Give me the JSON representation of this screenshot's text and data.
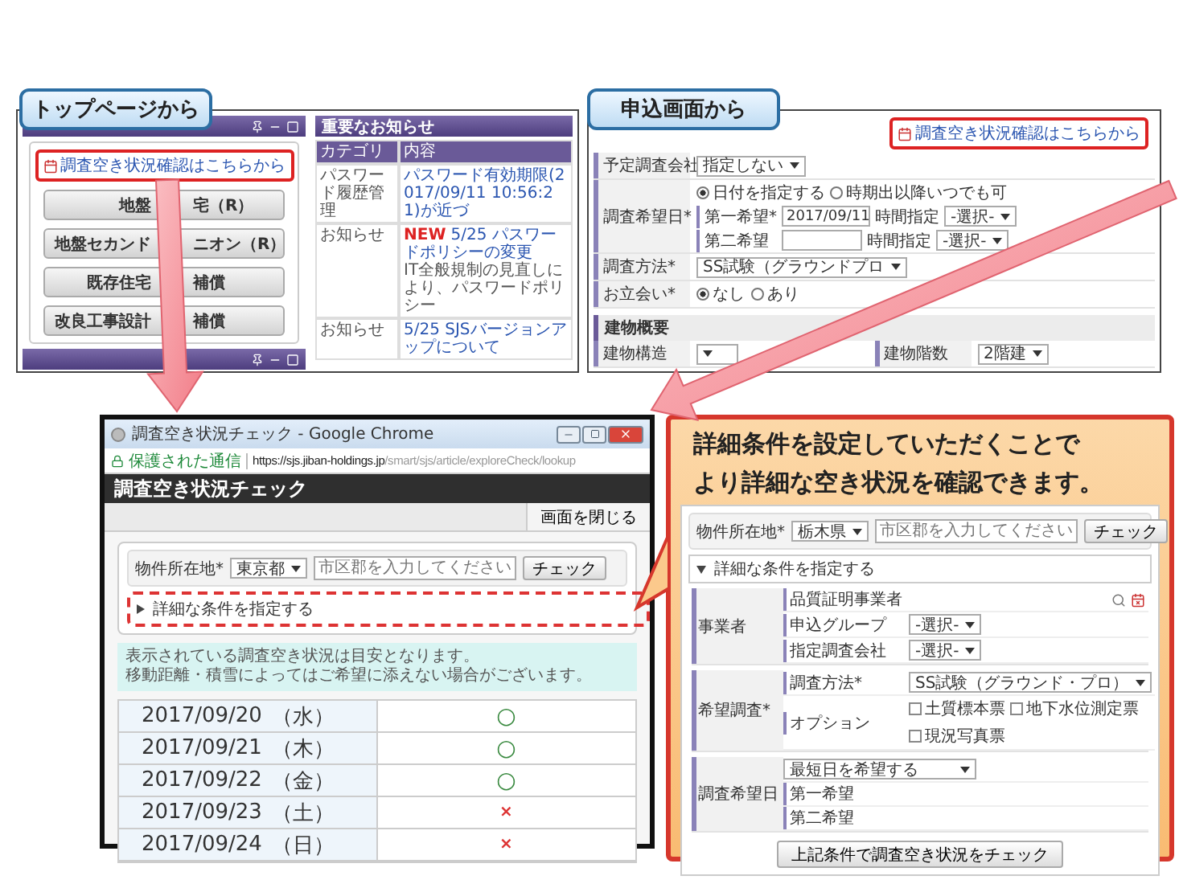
{
  "top_page": {
    "label": "トップページから",
    "link": "調査空き状況確認はこちらから",
    "buttons": [
      {
        "left": "地盤",
        "right": "宅（R）"
      },
      {
        "left": "地盤セカンド",
        "right": "ニオン（R）"
      },
      {
        "left": "既存住宅",
        "right": "補償"
      },
      {
        "left": "改良工事設計",
        "right": "補償"
      }
    ],
    "notices": {
      "title": "重要なお知らせ",
      "columns": [
        "カテゴリ",
        "内容"
      ],
      "rows": [
        {
          "category": "パスワード履歴管理",
          "title": "パスワード有効期限(2017/09/11 10:56:21)が近づ"
        },
        {
          "category": "お知らせ",
          "badge": "NEW",
          "title": "5/25 パスワードポリシーの変更",
          "body": "IT全般規制の見直しにより、パスワードポリシー"
        },
        {
          "category": "お知らせ",
          "title": "5/25 SJSバージョンアップについて"
        }
      ]
    }
  },
  "application": {
    "label": "申込画面から",
    "link": "調査空き状況確認はこちらから",
    "company": {
      "label": "予定調査会社",
      "value": "指定しない"
    },
    "date": {
      "label": "調査希望日*",
      "options": [
        {
          "label": "日付を指定する",
          "selected": true
        },
        {
          "label": "時期出以降いつでも可",
          "selected": false
        }
      ],
      "first": {
        "label": "第一希望*",
        "value": "2017/09/11",
        "time_label": "時間指定",
        "time_value": "-選択-"
      },
      "second": {
        "label": "第二希望",
        "time_label": "時間指定",
        "time_value": "-選択-"
      }
    },
    "method": {
      "label": "調査方法*",
      "value": "SS試験（グラウンドプロ"
    },
    "attendance": {
      "label": "お立会い*",
      "options": [
        {
          "label": "なし",
          "selected": true
        },
        {
          "label": "あり",
          "selected": false
        }
      ]
    },
    "building": {
      "title": "建物概要",
      "fields": [
        {
          "label": "建物構造"
        },
        {
          "label": "建物階数",
          "value": "2階建"
        }
      ]
    }
  },
  "chrome": {
    "title": "調査空き状況チェック - Google Chrome",
    "secure": "保護された通信",
    "url_host": "https://sjs.jiban-holdings.jp",
    "url_path": "/smart/sjs/article/exploreCheck/lookup",
    "header": "調査空き状況チェック",
    "close_button": "画面を閉じる",
    "location_label": "物件所在地*",
    "prefecture": "東京都",
    "city_placeholder": "市区郡を入力してください",
    "check_button": "チェック",
    "details_toggle": {
      "label": "詳細な条件を指定する",
      "expanded": false
    },
    "notes": [
      "表示されている調査空き状況は目安となります。",
      "移動距離・積雪によってはご希望に添えない場合がございます。"
    ],
    "availability": [
      {
        "date": "2017/09/20",
        "weekday": "（水）",
        "available": true,
        "mark": "○"
      },
      {
        "date": "2017/09/21",
        "weekday": "（木）",
        "available": true,
        "mark": "○"
      },
      {
        "date": "2017/09/22",
        "weekday": "（金）",
        "available": true,
        "mark": "○"
      },
      {
        "date": "2017/09/23",
        "weekday": "（土）",
        "available": false,
        "mark": "×"
      },
      {
        "date": "2017/09/24",
        "weekday": "（日）",
        "available": false,
        "mark": "×"
      }
    ]
  },
  "callout": {
    "headline": [
      "詳細条件を設定していただくことで",
      "より詳細な空き状況を確認できます。"
    ],
    "location_label": "物件所在地*",
    "prefecture": "栃木県",
    "city_placeholder": "市区郡を入力してください",
    "check_button": "チェック",
    "details_toggle": {
      "label": "詳細な条件を指定する",
      "expanded": true
    },
    "groups": [
      {
        "label": "事業者",
        "rows": [
          {
            "kind": "lookup",
            "label": "品質証明事業者"
          },
          {
            "kind": "select",
            "label": "申込グループ",
            "value": "-選択-"
          },
          {
            "kind": "select",
            "label": "指定調査会社",
            "value": "-選択-"
          }
        ]
      },
      {
        "label": "希望調査*",
        "rows": [
          {
            "kind": "select",
            "label": "調査方法*",
            "value": "SS試験（グラウンド・プロ）"
          },
          {
            "kind": "checks",
            "label": "オプション",
            "options": [
              {
                "label": "土質標本票",
                "checked": false
              },
              {
                "label": "地下水位測定票",
                "checked": false
              },
              {
                "label": "現況写真票",
                "checked": false
              }
            ]
          }
        ]
      },
      {
        "label": "調査希望日",
        "rows": [
          {
            "kind": "wide_select",
            "value": "最短日を希望する"
          },
          {
            "kind": "empty",
            "label": "第一希望"
          },
          {
            "kind": "empty",
            "label": "第二希望"
          }
        ]
      }
    ],
    "submit": "上記条件で調査空き状況をチェック"
  }
}
